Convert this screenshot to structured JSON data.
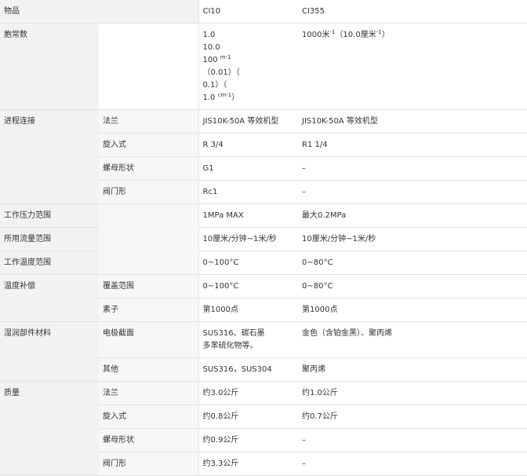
{
  "header": {
    "item": "物品",
    "col1": "CI10",
    "col2": "CI355"
  },
  "range": {
    "label": "胞常数",
    "ci10_lines": [
      "1.0",
      "10.0"
    ],
    "ci10_l3": "100",
    "ci10_l3_sup": "m-1",
    "ci10_l4": "（0.01）（",
    "ci10_l5": "0.1）（",
    "ci10_l6": "1.0",
    "ci10_l6_sup": "cm-1",
    "ci10_l6_end": "）",
    "ci355_a": "1000米",
    "ci355_a_sup": "-1",
    "ci355_b": "（10.0厘米",
    "ci355_b_sup": "-1",
    "ci355_c": "）"
  },
  "connection": {
    "label": "进程连接",
    "rows": [
      {
        "sub": "法兰",
        "ci10": "JIS10K-50A 等效机型",
        "ci355": "JIS10K-50A 等效机型"
      },
      {
        "sub": "旋入式",
        "ci10": "R 3/4",
        "ci355": "R1 1/4"
      },
      {
        "sub": "螺母形状",
        "ci10": "G1",
        "ci355": "–"
      },
      {
        "sub": "阀门形",
        "ci10": "Rc1",
        "ci355": "–"
      }
    ]
  },
  "pressure": {
    "label": "工作压力范围",
    "ci10": "1MPa MAX",
    "ci355": "最大0.2MPa"
  },
  "flow": {
    "label": "所用流量范围",
    "ci10": "10厘米/分钟~1米/秒",
    "ci355": "10厘米/分钟~1米/秒"
  },
  "temp": {
    "label": "工作温度范围",
    "ci10": "0~100°C",
    "ci355": "0~80°C"
  },
  "compensation": {
    "label": "温度补偿",
    "rows": [
      {
        "sub": "覆盖范围",
        "ci10": "0~100°C",
        "ci355": "0~80°C"
      },
      {
        "sub": "素子",
        "ci10": "第1000点",
        "ci355": "第1000点"
      }
    ]
  },
  "wetted": {
    "label": "湿润部件材料",
    "electrode": {
      "sub": "电极截面",
      "ci10_lines": [
        "SUS316、碳石墨",
        "多苯硫化物等。"
      ],
      "ci355": "金色（含铂金黑）、聚丙烯"
    },
    "other": {
      "sub": "其他",
      "ci10": "SUS316，SUS304",
      "ci355": "聚丙烯"
    }
  },
  "mass": {
    "label": "质量",
    "rows": [
      {
        "sub": "法兰",
        "ci10": "约3.0公斤",
        "ci355": "约1.0公斤"
      },
      {
        "sub": "旋入式",
        "ci10": "约0.8公斤",
        "ci355": "约0.7公斤"
      },
      {
        "sub": "螺母形状",
        "ci10": "约0.9公斤",
        "ci355": "–"
      },
      {
        "sub": "阀门形",
        "ci10": "约3.3公斤",
        "ci355": "–"
      }
    ]
  }
}
